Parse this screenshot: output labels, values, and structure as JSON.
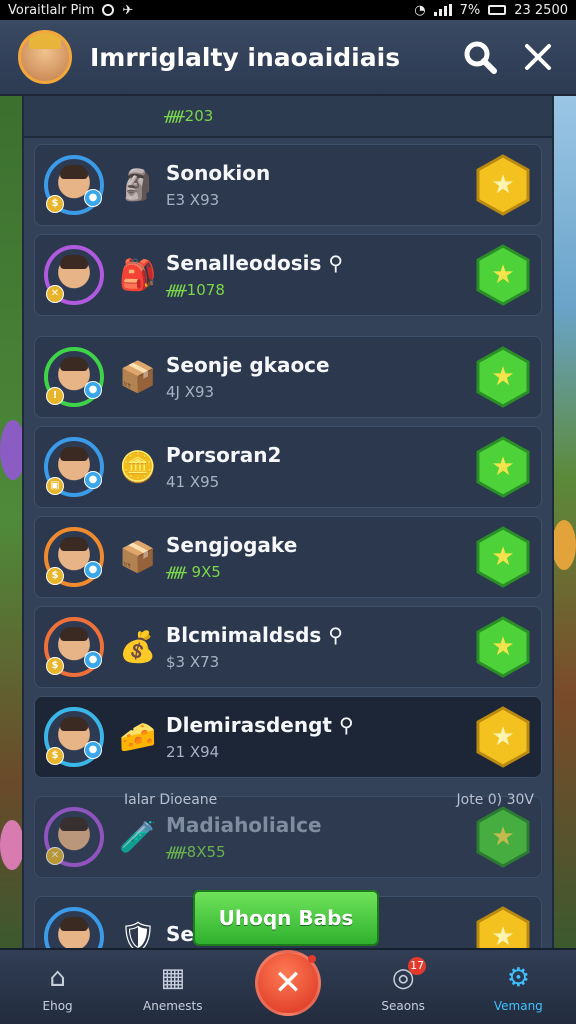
{
  "status_bar": {
    "left_text": "Voraitlalr Pim",
    "battery_text": "7%",
    "time": "23 2500"
  },
  "header": {
    "title": "Imrriglalty inaoaidiais"
  },
  "peek_row": {
    "value": "ᚏ203"
  },
  "rows": [
    {
      "name": "Sonokion",
      "sub": "E3 X93",
      "sub_color": "gray",
      "item_icon": "🗿",
      "action_color": "yellow",
      "avatar_ring": "#3b9be8",
      "badge_left": "$",
      "badge_right": "●"
    },
    {
      "name": "Senalleodosis ⚲",
      "sub": "ᚏ1078",
      "sub_color": "green",
      "item_icon": "🎒",
      "action_color": "green",
      "avatar_ring": "#b05ae0",
      "badge_left": "✕",
      "badge_right": ""
    },
    {
      "name": "Seonje gkaoce",
      "sub": "4J X93",
      "sub_color": "gray",
      "item_icon": "📦",
      "action_color": "green",
      "avatar_ring": "#3fd34a",
      "badge_left": "!",
      "badge_right": "●"
    },
    {
      "name": "Porsoran2",
      "sub": "41 X95",
      "sub_color": "gray",
      "item_icon": "🪙",
      "action_color": "green",
      "avatar_ring": "#3b9be8",
      "badge_left": "▣",
      "badge_right": "●"
    },
    {
      "name": "Sengjogake",
      "sub": "ᚏ 9X5",
      "sub_color": "green",
      "item_icon": "📦",
      "action_color": "green",
      "avatar_ring": "#f08a2e",
      "badge_left": "$",
      "badge_right": "●"
    },
    {
      "name": "Blcmimaldsds ⚲",
      "sub": "$3 X73",
      "sub_color": "gray",
      "item_icon": "💰",
      "action_color": "green",
      "avatar_ring": "#f0703a",
      "badge_left": "$",
      "badge_right": "●"
    },
    {
      "name": "Dlemirasdengt ⚲",
      "sub": "21 X94",
      "sub_color": "gray",
      "item_icon": "🧀",
      "action_color": "yellow",
      "avatar_ring": "#3bb6e8",
      "badge_left": "$",
      "badge_right": "●",
      "dark": true
    },
    {
      "name": "Madiaholialce",
      "sub": "ᚏ8X55",
      "sub_color": "green",
      "item_icon": "🧪",
      "action_color": "green",
      "avatar_ring": "#b05ae0",
      "badge_left": "✕",
      "badge_right": "",
      "dim": true
    },
    {
      "name": "Se",
      "sub": "",
      "sub_color": "gray",
      "item_icon": "🛡",
      "action_color": "yellow",
      "avatar_ring": "#3b9be8",
      "badge_left": "",
      "badge_right": ""
    }
  ],
  "section": {
    "left": "Ialar Dioeane",
    "right": "Jote 0) 30V"
  },
  "green_button": {
    "label": "Uhoqn Babs"
  },
  "bottom_nav": [
    {
      "label": "Ehog",
      "icon": "home-icon"
    },
    {
      "label": "Anemests",
      "icon": "stats-icon"
    },
    {
      "label": "",
      "icon": "close-icon",
      "badge": ""
    },
    {
      "label": "Seaons",
      "icon": "chat-icon",
      "badge": "17"
    },
    {
      "label": "Vemang",
      "icon": "gear-icon",
      "active": true
    }
  ],
  "colors": {
    "accent_yellow": "#f4c21f",
    "accent_green": "#4dd23a",
    "active_nav": "#3fc0ff",
    "danger": "#e23b2e"
  }
}
